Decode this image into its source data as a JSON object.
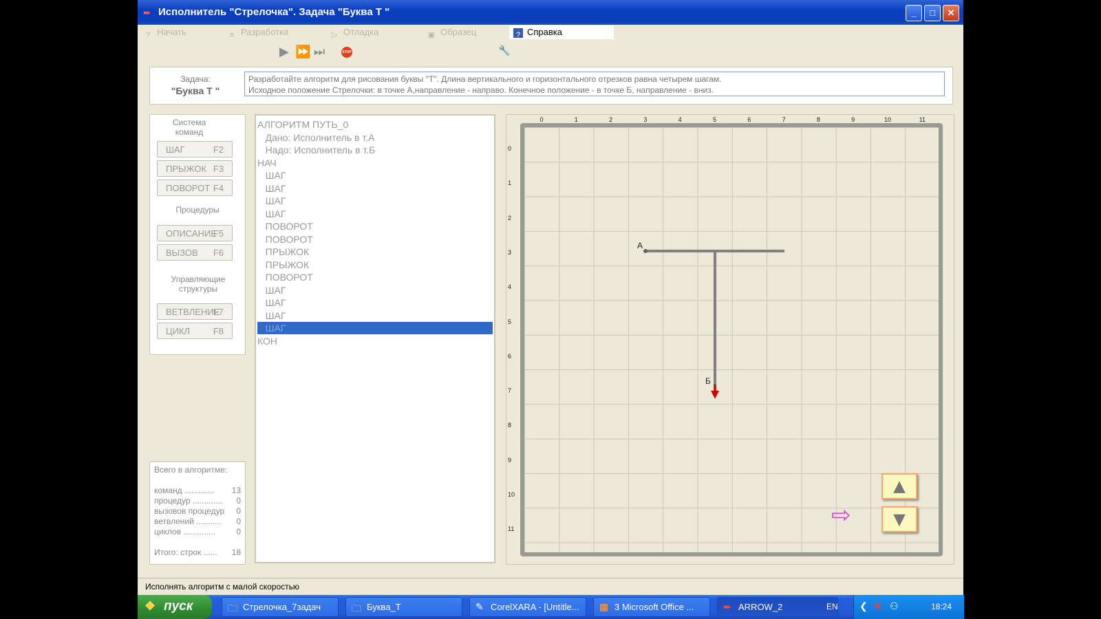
{
  "window": {
    "title": "Исполнитель \"Стрелочка\".  Задача  \"Буква Т \"",
    "buttons": {
      "minimize": "_",
      "maximize": "□",
      "close": "✕"
    }
  },
  "menu": [
    {
      "label": "Начать",
      "icon": "help-icon",
      "glyph": "?"
    },
    {
      "label": "Разработка",
      "icon": "document-icon",
      "glyph": "≡"
    },
    {
      "label": "Отладка",
      "icon": "play-icon",
      "glyph": "▷"
    },
    {
      "label": "Образец",
      "icon": "image-icon",
      "glyph": "▣"
    },
    {
      "label": "Справка",
      "icon": "help-book-icon",
      "glyph": "?"
    }
  ],
  "toolbar": {
    "run": "▶",
    "step": "⏩",
    "fast": "⏭",
    "stop": "STOP",
    "tools": "🔧"
  },
  "task": {
    "label": "Задача:",
    "name": "\"Буква Т \"",
    "line1": "Разработайте алгоритм для рисования буквы \"Т\". Длина  вертикального и горизонтального отрезков равна четырем шагам.",
    "line2": "Исходное положение Стрелочки: в точке А,направление - направо. Конечное положение - в  точке Б, направление - вниз."
  },
  "commands": {
    "system_title": "Система команд",
    "buttons": [
      {
        "label": "ШАГ",
        "key": "F2"
      },
      {
        "label": "ПРЫЖОК",
        "key": "F3"
      },
      {
        "label": "ПОВОРОТ",
        "key": "F4"
      }
    ],
    "procedures_title": "Процедуры",
    "proc_buttons": [
      {
        "label": "ОПИСАНИЕ",
        "key": "F5"
      },
      {
        "label": "ВЫЗОВ",
        "key": "F6"
      }
    ],
    "control_title": "Управляющие структуры",
    "control_buttons": [
      {
        "label": "ВЕТВЛЕНИЕ",
        "key": "F7"
      },
      {
        "label": "ЦИКЛ",
        "key": "F8"
      }
    ]
  },
  "stats": {
    "title": "Всего в алгоритме:",
    "rows": [
      {
        "label": "команд  .............",
        "value": "13"
      },
      {
        "label": "процедур  .............",
        "value": "0"
      },
      {
        "label": "вызовов процедур",
        "value": "0"
      },
      {
        "label": "ветвлений  ...........",
        "value": "0"
      },
      {
        "label": "циклов  ..............",
        "value": "0"
      }
    ],
    "total_label": "Итого:  строк  ......",
    "total_value": "18"
  },
  "code": [
    "АЛГОРИТМ ПУТЬ_0",
    "   Дано: Исполнитель в т.А",
    "   Надо: Исполнитель в т.Б",
    "НАЧ",
    "   ШАГ",
    "   ШАГ",
    "   ШАГ",
    "   ШАГ",
    "   ПОВОРОТ",
    "   ПОВОРОТ",
    "   ПРЫЖОК",
    "   ПРЫЖОК",
    "   ПОВОРОТ",
    "   ШАГ",
    "   ШАГ",
    "   ШАГ",
    "   ШАГ",
    "КОН"
  ],
  "code_selected_index": 16,
  "field": {
    "x_ticks": [
      "0",
      "1",
      "2",
      "3",
      "4",
      "5",
      "6",
      "7",
      "8",
      "9",
      "10",
      "11"
    ],
    "y_ticks": [
      "0",
      "1",
      "2",
      "3",
      "4",
      "5",
      "6",
      "7",
      "8",
      "9",
      "10",
      "11"
    ],
    "point_a": "А",
    "point_b": "Б",
    "up_button": "▲",
    "down_button": "▼",
    "arrow_pointer": "⇨",
    "line_color": "#808080",
    "arrow_color": "#d40000"
  },
  "status": "Исполнять алгоритм с малой скоростью",
  "taskbar": {
    "start": "пуск",
    "items": [
      {
        "label": "Стрелочка_7задач",
        "icon": "folder-icon"
      },
      {
        "label": "Буква_Т",
        "icon": "folder-icon"
      },
      {
        "label": "CorelXARA - [Untitle...",
        "icon": "corelxara-icon"
      },
      {
        "label": "3 Microsoft Office ...",
        "icon": "office-icon"
      },
      {
        "label": "ARROW_2",
        "icon": "arrow-app-icon"
      }
    ],
    "lang": "EN",
    "time": "18:24"
  }
}
